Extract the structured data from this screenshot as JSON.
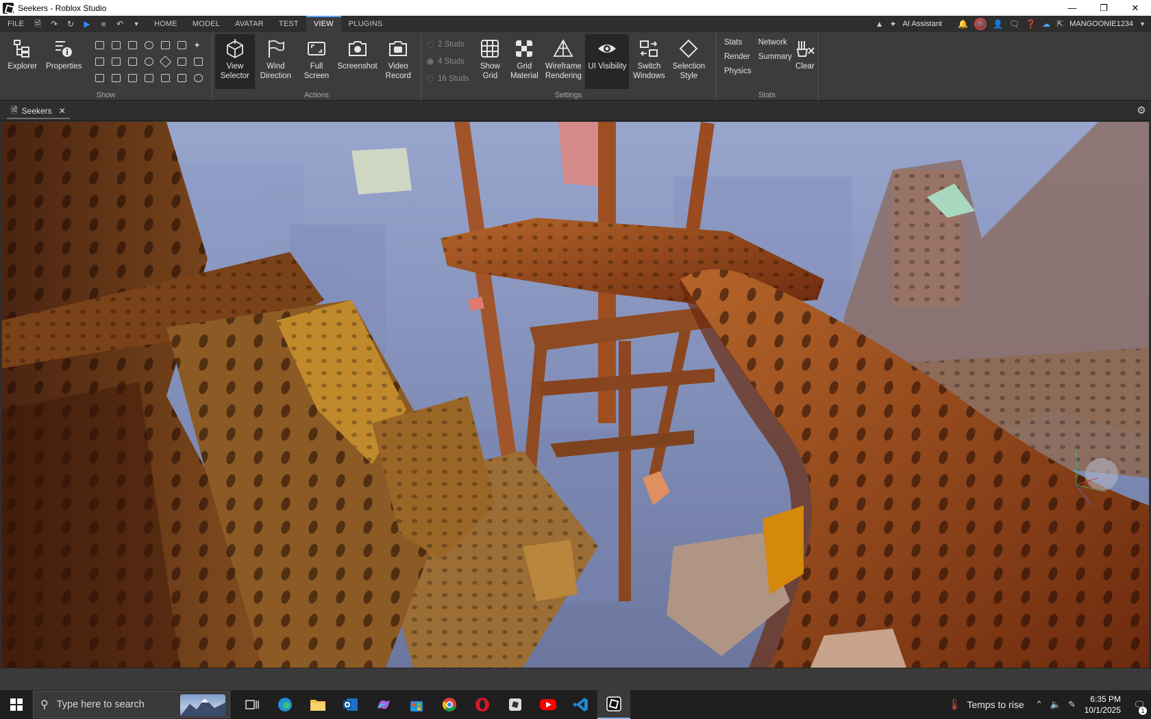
{
  "window": {
    "title": "Seekers - Roblox Studio"
  },
  "menu": {
    "tabs": [
      "FILE",
      "HOME",
      "MODEL",
      "AVATAR",
      "TEST",
      "VIEW",
      "PLUGINS"
    ],
    "active_tab": "VIEW",
    "ai_assistant": "AI Assistant",
    "username": "MANGOONIE1234"
  },
  "ribbon": {
    "show": {
      "explorer": "Explorer",
      "properties": "Properties",
      "label": "Show"
    },
    "actions": {
      "view_selector": "View Selector",
      "wind_direction": "Wind Direction",
      "full_screen": "Full Screen",
      "screenshot": "Screenshot",
      "video_record": "Video Record",
      "label": "Actions"
    },
    "settings": {
      "studs": [
        "2 Studs",
        "4 Studs",
        "16 Studs"
      ],
      "show_grid": "Show Grid",
      "grid_material": "Grid Material",
      "wireframe_rendering": "Wireframe Rendering",
      "ui_visibility": "UI Visibility",
      "switch_windows": "Switch Windows",
      "selection_style": "Selection Style",
      "label": "Settings"
    },
    "stats": {
      "col1": [
        "Stats",
        "Render",
        "Physics"
      ],
      "col2": [
        "Network",
        "Summary"
      ],
      "clear": "Clear",
      "label": "Stats"
    }
  },
  "document": {
    "tab_label": "Seekers"
  },
  "taskbar": {
    "search_placeholder": "Type here to search",
    "weather": "Temps to rise",
    "time": "6:35 PM",
    "date": "10/1/2025",
    "notification_count": "1"
  },
  "colors": {
    "accent": "#5ba6ff",
    "play": "#2e8bff",
    "sky": "#8394c0",
    "wood": "#a0521e"
  }
}
